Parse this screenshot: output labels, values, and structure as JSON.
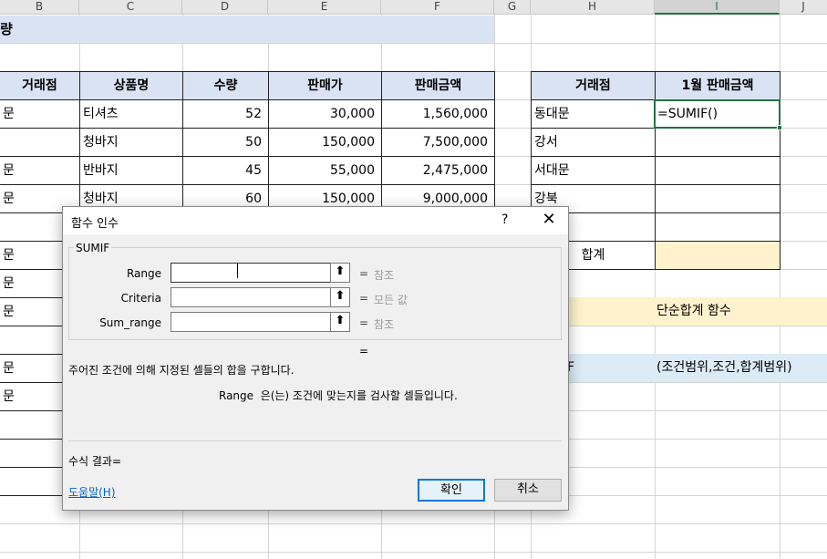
{
  "columns": [
    "B",
    "C",
    "D",
    "E",
    "F",
    "G",
    "H",
    "I",
    "J"
  ],
  "title": "량",
  "sales_table": {
    "headers": [
      "거래점",
      "상품명",
      "수량",
      "판매가",
      "판매금액"
    ],
    "rows": [
      {
        "store": "문",
        "product": "티셔츠",
        "qty": "52",
        "price": "30,000",
        "amount": "1,560,000"
      },
      {
        "store": "",
        "product": "청바지",
        "qty": "50",
        "price": "150,000",
        "amount": "7,500,000"
      },
      {
        "store": "문",
        "product": "반바지",
        "qty": "45",
        "price": "55,000",
        "amount": "2,475,000"
      },
      {
        "store": "문",
        "product": "청바지",
        "qty": "60",
        "price": "150,000",
        "amount": "9,000,000"
      }
    ],
    "extra_store_cells": [
      "문",
      "문",
      "문",
      "",
      "문",
      "문"
    ]
  },
  "summary_table": {
    "headers": [
      "거래점",
      "1월 판매금액"
    ],
    "rows": [
      "동대문",
      "강서",
      "서대문",
      "강북"
    ],
    "total_label": "합계",
    "formula": "=SUMIF()"
  },
  "notes": {
    "note1": "단순합계 함수",
    "note2_prefix": "F",
    "note2": "(조건범위,조건,합계범위)"
  },
  "dialog": {
    "title": "함수 인수",
    "help_char": "?",
    "close_char": "✕",
    "function_name": "SUMIF",
    "args": [
      {
        "label": "Range",
        "hint": "참조"
      },
      {
        "label": "Criteria",
        "hint": "모든 값"
      },
      {
        "label": "Sum_range",
        "hint": "참조"
      }
    ],
    "equals": "=",
    "description": "주어진 조건에 의해 지정된 셀들의 합을 구합니다.",
    "arg_description": "Range  은(는) 조건에 맞는지를 검사할 셀들입니다.",
    "result_label": "수식 결과=",
    "help_link": "도움말(H)",
    "ok": "확인",
    "cancel": "취소"
  },
  "colors": {
    "header_fill": "#dae3f3",
    "total_fill": "#fff2cc",
    "note1_fill": "#fff2cc",
    "note2_fill": "#ddebf7",
    "accent": "#217346"
  }
}
